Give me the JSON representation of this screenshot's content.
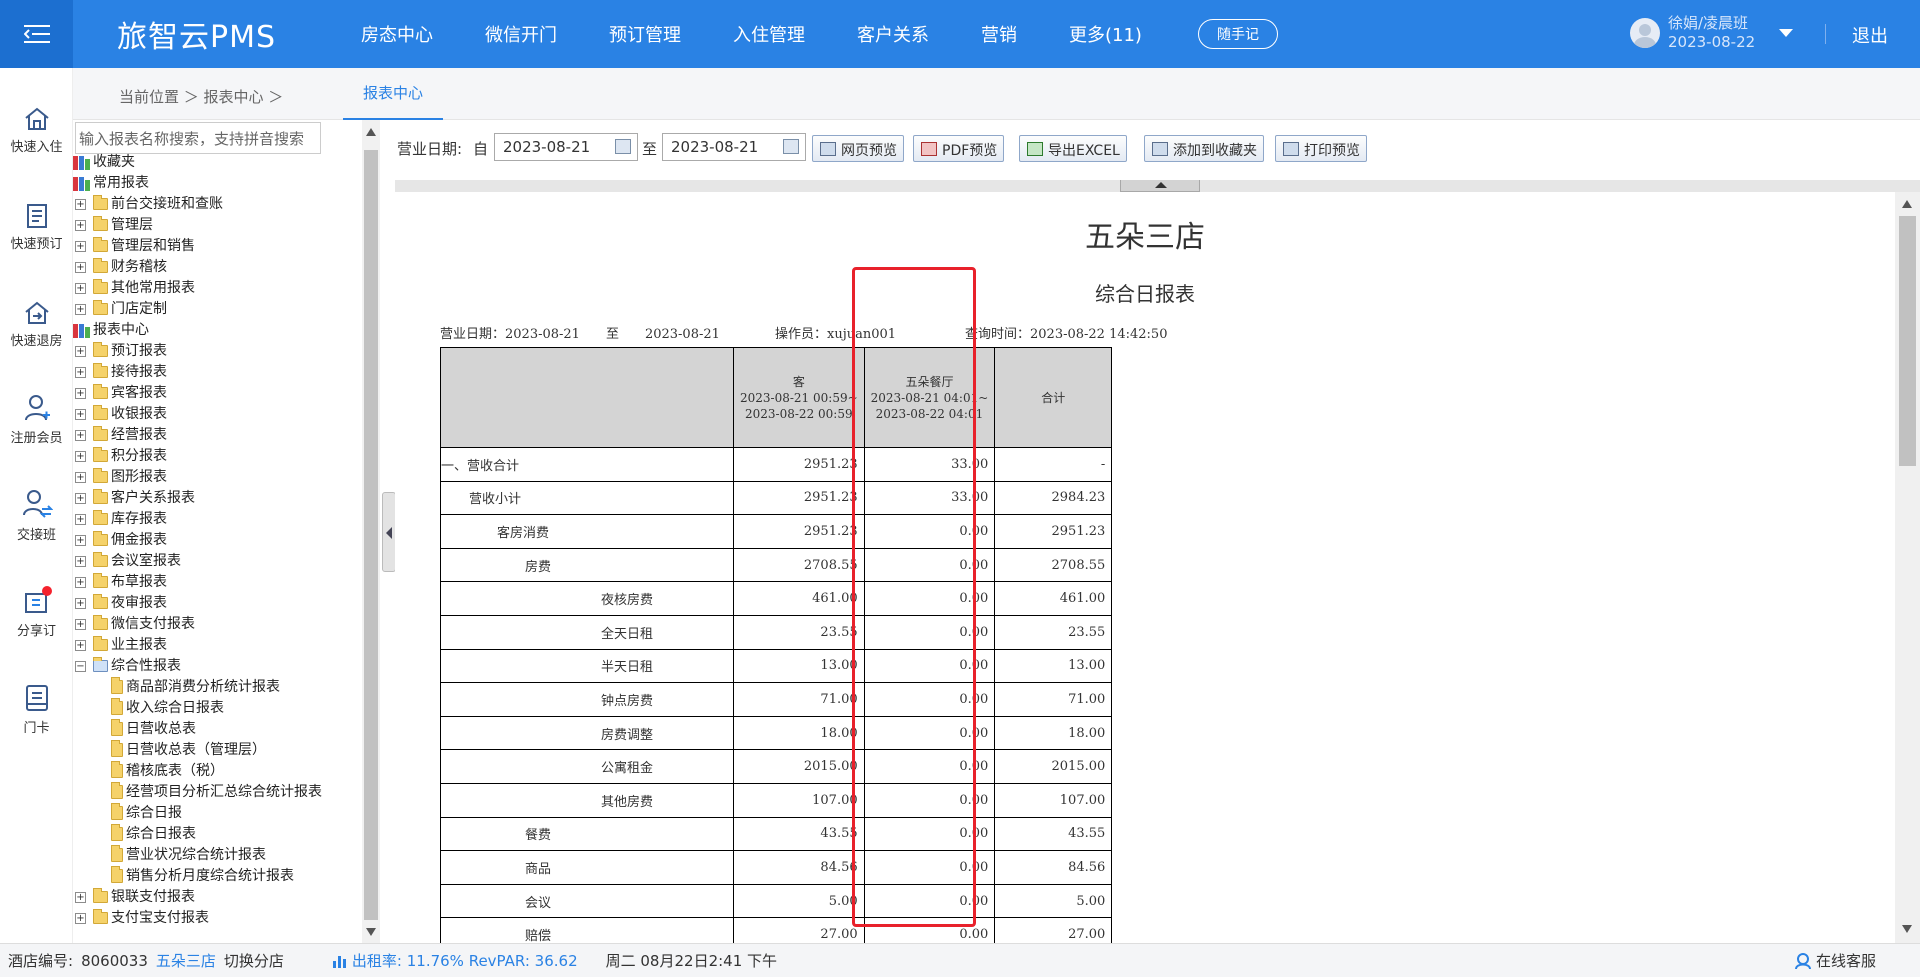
{
  "topbar": {
    "brand": "旅智云PMS",
    "nav": [
      "房态中心",
      "微信开门",
      "预订管理",
      "入住管理",
      "客户关系",
      "营销",
      "更多(11)"
    ],
    "memo_button": "随手记",
    "user_name": "徐娟/凌晨班",
    "user_date": "2023-08-22",
    "logout": "退出",
    "brand_color": "#2a82e4"
  },
  "sidebar": {
    "items": [
      {
        "label": "快速入住",
        "icon": "home-icon"
      },
      {
        "label": "快速预订",
        "icon": "booking-icon"
      },
      {
        "label": "快速退房",
        "icon": "checkout-icon"
      },
      {
        "label": "注册会员",
        "icon": "add-member-icon"
      },
      {
        "label": "交接班",
        "icon": "shift-handover-icon"
      },
      {
        "label": "分享订",
        "icon": "share-order-icon"
      },
      {
        "label": "门卡",
        "icon": "door-card-icon"
      }
    ]
  },
  "breadcrumb": {
    "text": "当前位置 ＞ 报表中心 ＞",
    "active_tab": "报表中心"
  },
  "tree": {
    "search_placeholder": "输入报表名称搜索，支持拼音搜索",
    "favorites": "收藏夹",
    "common": "常用报表",
    "common_items": [
      "前台交接班和查账",
      "管理层",
      "管理层和销售",
      "财务稽核",
      "其他常用报表",
      "门店定制"
    ],
    "center": "报表中心",
    "center_items": [
      "预订报表",
      "接待报表",
      "宾客报表",
      "收银报表",
      "经营报表",
      "积分报表",
      "图形报表",
      "客户关系报表",
      "库存报表",
      "佣金报表",
      "会议室报表",
      "布草报表",
      "夜审报表",
      "微信支付报表",
      "业主报表"
    ],
    "composite": "综合性报表",
    "composite_items": [
      "商品部消费分析统计报表",
      "收入综合日报表",
      "日营收总表",
      "日营收总表（管理层）",
      "稽核底表（税）",
      "经营项目分析汇总综合统计报表",
      "综合日报",
      "综合日报表",
      "营业状况综合统计报表",
      "销售分析月度综合统计报表"
    ],
    "after_items": [
      "银联支付报表",
      "支付宝支付报表"
    ]
  },
  "toolbar": {
    "date_label": "营业日期:",
    "from_label": "自",
    "from_date": "2023-08-21",
    "to_label": "至",
    "to_date": "2023-08-21",
    "buttons": [
      "网页预览",
      "PDF预览",
      "导出EXCEL",
      "添加到收藏夹",
      "打印预览"
    ]
  },
  "report": {
    "hotel": "五朵三店",
    "title": "综合日报表",
    "meta_date": "营业日期：2023-08-21　　至　　2023-08-21",
    "meta_operator": "操作员：xujuan001",
    "meta_query": "查询时间：2023-08-22 14:42:50",
    "columns": [
      {
        "name": "客",
        "line1": "2023-08-21 00:59~",
        "line2": "2023-08-22 00:59"
      },
      {
        "name": "五朵餐厅",
        "line1": "2023-08-21 04:01~",
        "line2": "2023-08-22 04:01"
      },
      {
        "name": "合计",
        "line1": "",
        "line2": ""
      }
    ],
    "rows": [
      {
        "label": "一、营收合计",
        "indent": 0,
        "v1": "2951.23",
        "v2": "33.00",
        "v3": "-"
      },
      {
        "label": "营收小计",
        "indent": 1,
        "v1": "2951.23",
        "v2": "33.00",
        "v3": "2984.23"
      },
      {
        "label": "客房消费",
        "indent": 2,
        "v1": "2951.23",
        "v2": "0.00",
        "v3": "2951.23"
      },
      {
        "label": "房费",
        "indent": 3,
        "v1": "2708.55",
        "v2": "0.00",
        "v3": "2708.55"
      },
      {
        "label": "夜核房费",
        "indent": 5,
        "v1": "461.00",
        "v2": "0.00",
        "v3": "461.00"
      },
      {
        "label": "全天日租",
        "indent": 5,
        "v1": "23.55",
        "v2": "0.00",
        "v3": "23.55"
      },
      {
        "label": "半天日租",
        "indent": 5,
        "v1": "13.00",
        "v2": "0.00",
        "v3": "13.00"
      },
      {
        "label": "钟点房费",
        "indent": 5,
        "v1": "71.00",
        "v2": "0.00",
        "v3": "71.00"
      },
      {
        "label": "房费调整",
        "indent": 5,
        "v1": "18.00",
        "v2": "0.00",
        "v3": "18.00"
      },
      {
        "label": "公寓租金",
        "indent": 5,
        "v1": "2015.00",
        "v2": "0.00",
        "v3": "2015.00"
      },
      {
        "label": "其他房费",
        "indent": 5,
        "v1": "107.00",
        "v2": "0.00",
        "v3": "107.00"
      },
      {
        "label": "餐费",
        "indent": 3,
        "v1": "43.55",
        "v2": "0.00",
        "v3": "43.55"
      },
      {
        "label": "商品",
        "indent": 3,
        "v1": "84.56",
        "v2": "0.00",
        "v3": "84.56"
      },
      {
        "label": "会议",
        "indent": 3,
        "v1": "5.00",
        "v2": "0.00",
        "v3": "5.00"
      },
      {
        "label": "赔偿",
        "indent": 3,
        "v1": "27.00",
        "v2": "0.00",
        "v3": "27.00"
      }
    ]
  },
  "status": {
    "hotel_no_label": "酒店编号:",
    "hotel_no": "8060033",
    "hotel_name": "五朵三店",
    "switch": "切换分店",
    "occupancy": "出租率:  11.76% RevPAR:  36.62",
    "datetime": "周二 08月22日2:41 下午",
    "support": "在线客服"
  }
}
